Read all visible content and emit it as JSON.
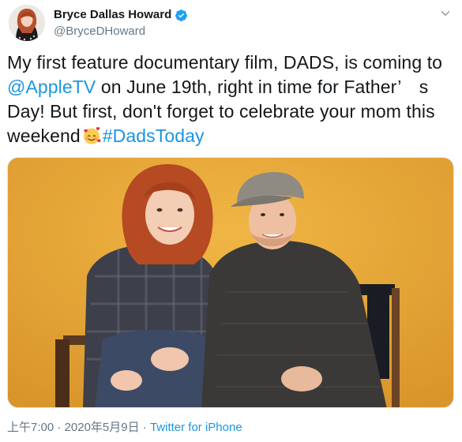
{
  "author": {
    "display_name": "Bryce Dallas Howard",
    "handle": "@BryceDHoward",
    "verified": true,
    "avatar_icon": "profile-photo"
  },
  "tweet": {
    "text_part1": "My first feature documentary film, DADS, is coming to ",
    "mention": "@AppleTV",
    "text_part2": " on June 19th, right in time for Father’　s Day! But first, don't forget to celebrate your mom this weekend",
    "emoji_name": "smiling-face-with-hearts-emoji",
    "hashtag": "#DadsToday"
  },
  "media": {
    "background_color": "#e3a636",
    "subject": "photo"
  },
  "meta": {
    "time": "上午7:00",
    "separator1": " · ",
    "date": "2020年5月9日",
    "separator2": " · ",
    "source": "Twitter for iPhone"
  },
  "colors": {
    "link": "#1b95e0",
    "secondary_text": "#657786",
    "primary_text": "#14171a"
  }
}
